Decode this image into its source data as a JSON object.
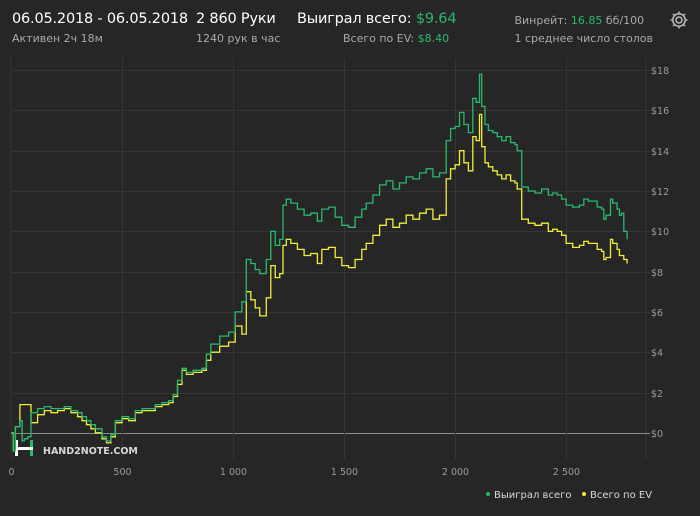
{
  "header": {
    "date_range": "06.05.2018 - 06.05.2018",
    "active_time": "Активен 2ч 18м",
    "hands": "2 860 Руки",
    "hands_per_hour": "1240 рук в час",
    "won_total_label": "Выиграл всего:",
    "won_total_value": "$9.64",
    "ev_total_label": "Всего по EV:",
    "ev_total_value": "$8.40",
    "winrate_label": "Винрейт:",
    "winrate_value": "16.85",
    "winrate_unit": "бб/100",
    "avg_tables": "1 среднее число столов",
    "settings_icon": "gear-icon"
  },
  "watermark": "HAND2NOTE.COM",
  "legend": {
    "won": "Выиграл всего",
    "ev": "Всего по EV"
  },
  "colors": {
    "won": "#29b96d",
    "ev": "#f1ee3a",
    "background": "#262626",
    "grid": "#353535",
    "zero_line": "#8a8a8a"
  },
  "chart_data": {
    "type": "line",
    "x_ticks": [
      0,
      500,
      1000,
      1500,
      2000,
      2500
    ],
    "x_tick_labels": [
      "0",
      "500",
      "1 000",
      "1 500",
      "2 000",
      "2 500"
    ],
    "y_ticks": [
      0,
      2,
      4,
      6,
      8,
      10,
      12,
      14,
      16,
      18
    ],
    "y_tick_labels": [
      "$0",
      "$2",
      "$4",
      "$6",
      "$8",
      "$10",
      "$12",
      "$14",
      "$16",
      "$18"
    ],
    "xlim": [
      0,
      2860
    ],
    "ylim": [
      -1.3,
      18.6
    ],
    "grid": true,
    "legend_position": "bottom-right",
    "series": [
      {
        "name": "Выиграл всего",
        "color": "#29b96d",
        "points": [
          [
            0,
            0.0
          ],
          [
            10,
            -0.9
          ],
          [
            20,
            0.3
          ],
          [
            40,
            0.6
          ],
          [
            50,
            -0.4
          ],
          [
            60,
            -0.3
          ],
          [
            75,
            -0.2
          ],
          [
            90,
            1.0
          ],
          [
            120,
            1.2
          ],
          [
            150,
            1.3
          ],
          [
            180,
            1.2
          ],
          [
            210,
            1.2
          ],
          [
            240,
            1.3
          ],
          [
            270,
            1.1
          ],
          [
            300,
            1.0
          ],
          [
            320,
            0.8
          ],
          [
            340,
            0.6
          ],
          [
            360,
            0.4
          ],
          [
            380,
            0.2
          ],
          [
            410,
            -0.2
          ],
          [
            430,
            -0.4
          ],
          [
            450,
            -0.1
          ],
          [
            470,
            0.6
          ],
          [
            500,
            0.8
          ],
          [
            530,
            0.7
          ],
          [
            560,
            1.1
          ],
          [
            590,
            1.2
          ],
          [
            620,
            1.2
          ],
          [
            650,
            1.4
          ],
          [
            680,
            1.5
          ],
          [
            710,
            1.6
          ],
          [
            730,
            1.9
          ],
          [
            750,
            2.6
          ],
          [
            770,
            3.2
          ],
          [
            790,
            3.0
          ],
          [
            820,
            3.1
          ],
          [
            860,
            3.2
          ],
          [
            880,
            3.9
          ],
          [
            900,
            4.4
          ],
          [
            940,
            4.8
          ],
          [
            980,
            5.0
          ],
          [
            1010,
            6.0
          ],
          [
            1040,
            6.5
          ],
          [
            1060,
            8.6
          ],
          [
            1080,
            8.4
          ],
          [
            1100,
            8.1
          ],
          [
            1120,
            7.9
          ],
          [
            1150,
            8.6
          ],
          [
            1170,
            10.0
          ],
          [
            1190,
            9.3
          ],
          [
            1210,
            9.6
          ],
          [
            1225,
            11.3
          ],
          [
            1240,
            11.6
          ],
          [
            1260,
            11.4
          ],
          [
            1290,
            11.1
          ],
          [
            1320,
            10.8
          ],
          [
            1350,
            10.9
          ],
          [
            1380,
            10.5
          ],
          [
            1400,
            11.1
          ],
          [
            1430,
            11.2
          ],
          [
            1460,
            10.7
          ],
          [
            1490,
            10.3
          ],
          [
            1520,
            10.2
          ],
          [
            1550,
            10.7
          ],
          [
            1580,
            11.1
          ],
          [
            1600,
            11.4
          ],
          [
            1630,
            11.8
          ],
          [
            1660,
            12.3
          ],
          [
            1690,
            12.5
          ],
          [
            1720,
            12.1
          ],
          [
            1750,
            12.4
          ],
          [
            1780,
            12.7
          ],
          [
            1810,
            12.6
          ],
          [
            1840,
            12.9
          ],
          [
            1870,
            13.1
          ],
          [
            1900,
            12.7
          ],
          [
            1930,
            12.9
          ],
          [
            1960,
            14.5
          ],
          [
            1980,
            15.1
          ],
          [
            2000,
            15.2
          ],
          [
            2020,
            15.9
          ],
          [
            2040,
            15.3
          ],
          [
            2060,
            14.9
          ],
          [
            2080,
            16.6
          ],
          [
            2095,
            16.4
          ],
          [
            2110,
            17.8
          ],
          [
            2120,
            16.2
          ],
          [
            2135,
            15.3
          ],
          [
            2150,
            15.0
          ],
          [
            2170,
            14.9
          ],
          [
            2190,
            14.7
          ],
          [
            2210,
            14.5
          ],
          [
            2230,
            14.7
          ],
          [
            2250,
            14.4
          ],
          [
            2270,
            14.3
          ],
          [
            2280,
            14.0
          ],
          [
            2300,
            12.2
          ],
          [
            2330,
            12.0
          ],
          [
            2360,
            11.9
          ],
          [
            2390,
            12.1
          ],
          [
            2420,
            11.8
          ],
          [
            2440,
            11.9
          ],
          [
            2460,
            11.8
          ],
          [
            2480,
            11.6
          ],
          [
            2500,
            11.3
          ],
          [
            2530,
            11.2
          ],
          [
            2560,
            11.3
          ],
          [
            2580,
            11.6
          ],
          [
            2600,
            11.5
          ],
          [
            2620,
            11.5
          ],
          [
            2640,
            11.2
          ],
          [
            2660,
            11.1
          ],
          [
            2670,
            10.6
          ],
          [
            2680,
            10.8
          ],
          [
            2700,
            11.6
          ],
          [
            2710,
            11.4
          ],
          [
            2730,
            11.1
          ],
          [
            2740,
            10.8
          ],
          [
            2750,
            10.9
          ],
          [
            2760,
            10.0
          ],
          [
            2775,
            9.6
          ]
        ]
      },
      {
        "name": "Всего по EV",
        "color": "#f1ee3a",
        "points": [
          [
            0,
            0.0
          ],
          [
            10,
            -0.9
          ],
          [
            20,
            0.3
          ],
          [
            40,
            1.4
          ],
          [
            70,
            1.4
          ],
          [
            90,
            0.5
          ],
          [
            120,
            0.9
          ],
          [
            150,
            1.1
          ],
          [
            180,
            1.0
          ],
          [
            210,
            1.1
          ],
          [
            240,
            1.2
          ],
          [
            270,
            1.0
          ],
          [
            300,
            0.8
          ],
          [
            320,
            0.6
          ],
          [
            340,
            0.4
          ],
          [
            360,
            0.2
          ],
          [
            380,
            0.0
          ],
          [
            410,
            -0.3
          ],
          [
            430,
            -0.5
          ],
          [
            450,
            -0.2
          ],
          [
            470,
            0.5
          ],
          [
            500,
            0.7
          ],
          [
            530,
            0.6
          ],
          [
            560,
            1.0
          ],
          [
            590,
            1.1
          ],
          [
            620,
            1.1
          ],
          [
            650,
            1.3
          ],
          [
            680,
            1.4
          ],
          [
            710,
            1.5
          ],
          [
            730,
            1.8
          ],
          [
            750,
            2.4
          ],
          [
            770,
            3.1
          ],
          [
            790,
            2.9
          ],
          [
            820,
            3.0
          ],
          [
            860,
            3.1
          ],
          [
            880,
            3.6
          ],
          [
            900,
            4.0
          ],
          [
            940,
            4.3
          ],
          [
            980,
            4.5
          ],
          [
            1010,
            5.3
          ],
          [
            1040,
            4.9
          ],
          [
            1060,
            7.0
          ],
          [
            1080,
            6.6
          ],
          [
            1100,
            6.2
          ],
          [
            1120,
            5.8
          ],
          [
            1150,
            6.7
          ],
          [
            1170,
            8.3
          ],
          [
            1190,
            7.7
          ],
          [
            1210,
            7.9
          ],
          [
            1225,
            9.3
          ],
          [
            1240,
            9.6
          ],
          [
            1260,
            9.4
          ],
          [
            1290,
            9.1
          ],
          [
            1320,
            8.8
          ],
          [
            1350,
            8.9
          ],
          [
            1380,
            8.4
          ],
          [
            1400,
            9.1
          ],
          [
            1430,
            9.2
          ],
          [
            1460,
            8.7
          ],
          [
            1490,
            8.3
          ],
          [
            1520,
            8.2
          ],
          [
            1550,
            8.6
          ],
          [
            1580,
            9.1
          ],
          [
            1600,
            9.4
          ],
          [
            1630,
            9.8
          ],
          [
            1660,
            10.3
          ],
          [
            1690,
            10.6
          ],
          [
            1720,
            10.2
          ],
          [
            1750,
            10.4
          ],
          [
            1780,
            10.8
          ],
          [
            1810,
            10.6
          ],
          [
            1840,
            10.9
          ],
          [
            1870,
            11.1
          ],
          [
            1900,
            10.6
          ],
          [
            1930,
            10.8
          ],
          [
            1960,
            12.6
          ],
          [
            1980,
            13.1
          ],
          [
            2000,
            13.3
          ],
          [
            2020,
            14.0
          ],
          [
            2040,
            13.4
          ],
          [
            2060,
            13.0
          ],
          [
            2080,
            14.7
          ],
          [
            2095,
            14.5
          ],
          [
            2110,
            15.8
          ],
          [
            2120,
            14.2
          ],
          [
            2135,
            13.4
          ],
          [
            2150,
            13.2
          ],
          [
            2170,
            13.0
          ],
          [
            2190,
            12.8
          ],
          [
            2210,
            12.6
          ],
          [
            2230,
            12.8
          ],
          [
            2250,
            12.5
          ],
          [
            2270,
            12.4
          ],
          [
            2280,
            12.1
          ],
          [
            2300,
            10.6
          ],
          [
            2330,
            10.4
          ],
          [
            2360,
            10.3
          ],
          [
            2390,
            10.4
          ],
          [
            2420,
            10.0
          ],
          [
            2440,
            10.1
          ],
          [
            2460,
            10.0
          ],
          [
            2480,
            9.8
          ],
          [
            2500,
            9.4
          ],
          [
            2530,
            9.2
          ],
          [
            2560,
            9.3
          ],
          [
            2580,
            9.5
          ],
          [
            2600,
            9.4
          ],
          [
            2620,
            9.4
          ],
          [
            2640,
            9.1
          ],
          [
            2660,
            9.0
          ],
          [
            2670,
            8.6
          ],
          [
            2680,
            8.7
          ],
          [
            2700,
            9.6
          ],
          [
            2710,
            9.4
          ],
          [
            2730,
            9.1
          ],
          [
            2740,
            8.8
          ],
          [
            2750,
            8.8
          ],
          [
            2760,
            8.6
          ],
          [
            2775,
            8.4
          ]
        ]
      }
    ]
  }
}
